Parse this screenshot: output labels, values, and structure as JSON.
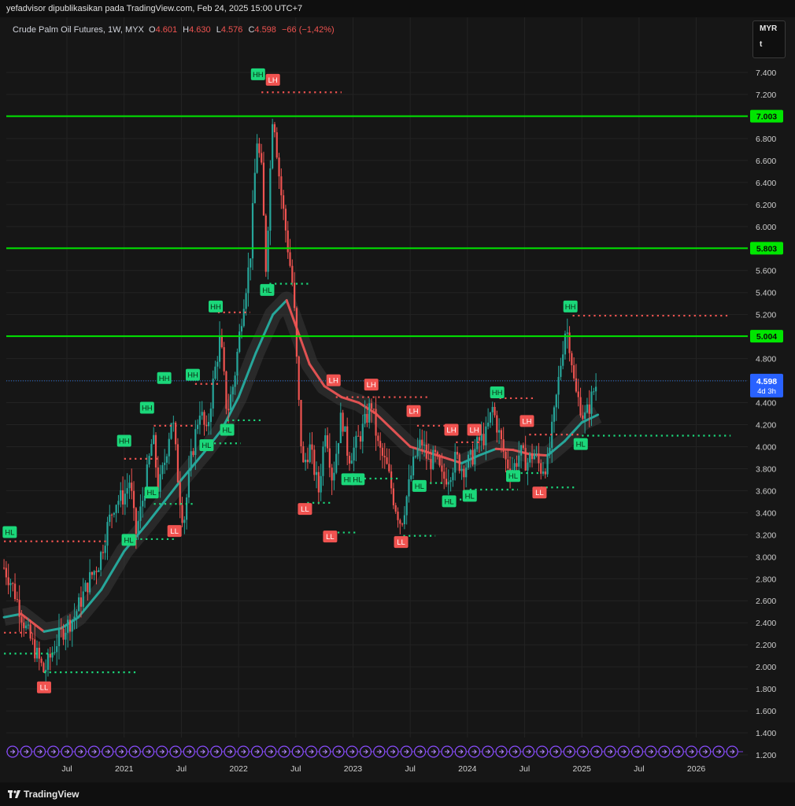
{
  "header": {
    "attribution": "yefadvisor dipublikasikan pada TradingView.com, Feb 24, 2025 15:00 UTC+7"
  },
  "legend": {
    "symbol": "Crude Palm Oil Futures, 1W, MYX",
    "o_label": "O",
    "o_value": "4.601",
    "h_label": "H",
    "h_value": "4.630",
    "l_label": "L",
    "l_value": "4.576",
    "c_label": "C",
    "c_value": "4.598",
    "change": "−66 (−1,42%)"
  },
  "currency": {
    "code": "MYR",
    "unit": "t"
  },
  "footer": {
    "brand": "TradingView"
  },
  "colors": {
    "up": "#26a69a",
    "down": "#ef5350",
    "level": "#00e600",
    "ma_up": "#26a69a",
    "ma_down": "#e05252",
    "hh": "#1bd77a",
    "lh": "#f05350"
  },
  "chart_data": {
    "type": "candlestick",
    "ylim": [
      1.15,
      7.55
    ],
    "x_range": [
      "2020-01",
      "2026-06"
    ],
    "y_ticks": [
      "1.200",
      "1.400",
      "1.600",
      "1.800",
      "2.000",
      "2.200",
      "2.400",
      "2.600",
      "2.800",
      "3.000",
      "3.200",
      "3.400",
      "3.600",
      "3.800",
      "4.000",
      "4.200",
      "4.400",
      "4.600",
      "4.800",
      "5.000",
      "5.200",
      "5.400",
      "5.600",
      "5.800",
      "6.000",
      "6.200",
      "6.400",
      "6.600",
      "6.800",
      "7.000",
      "7.200",
      "7.400"
    ],
    "x_ticks": [
      {
        "label": "Jul",
        "t": 2020.5
      },
      {
        "label": "2021",
        "t": 2021.0
      },
      {
        "label": "Jul",
        "t": 2021.5
      },
      {
        "label": "2022",
        "t": 2022.0
      },
      {
        "label": "Jul",
        "t": 2022.5
      },
      {
        "label": "2023",
        "t": 2023.0
      },
      {
        "label": "Jul",
        "t": 2023.5
      },
      {
        "label": "2024",
        "t": 2024.0
      },
      {
        "label": "Jul",
        "t": 2024.5
      },
      {
        "label": "2025",
        "t": 2025.0
      },
      {
        "label": "Jul",
        "t": 2025.5
      },
      {
        "label": "2026",
        "t": 2026.0
      }
    ],
    "horizontal_levels": [
      {
        "value": 7.003,
        "label": "7.003"
      },
      {
        "value": 5.803,
        "label": "5.803"
      },
      {
        "value": 5.004,
        "label": "5.004"
      }
    ],
    "last_price": {
      "value": 4.598,
      "label": "4.598",
      "countdown": "4d 3h"
    },
    "price_path": [
      [
        2019.95,
        2.9
      ],
      [
        2020.02,
        2.75
      ],
      [
        2020.08,
        2.55
      ],
      [
        2020.14,
        2.35
      ],
      [
        2020.2,
        2.2
      ],
      [
        2020.26,
        2.05
      ],
      [
        2020.3,
        1.95
      ],
      [
        2020.36,
        2.1
      ],
      [
        2020.42,
        2.25
      ],
      [
        2020.48,
        2.35
      ],
      [
        2020.56,
        2.45
      ],
      [
        2020.62,
        2.6
      ],
      [
        2020.7,
        2.8
      ],
      [
        2020.78,
        2.95
      ],
      [
        2020.86,
        3.3
      ],
      [
        2020.92,
        3.5
      ],
      [
        2021.0,
        3.55
      ],
      [
        2021.05,
        3.7
      ],
      [
        2021.1,
        3.2
      ],
      [
        2021.15,
        3.45
      ],
      [
        2021.2,
        3.75
      ],
      [
        2021.25,
        4.1
      ],
      [
        2021.3,
        3.6
      ],
      [
        2021.36,
        3.9
      ],
      [
        2021.42,
        4.3
      ],
      [
        2021.48,
        3.6
      ],
      [
        2021.52,
        3.3
      ],
      [
        2021.58,
        3.85
      ],
      [
        2021.66,
        4.35
      ],
      [
        2021.72,
        4.1
      ],
      [
        2021.78,
        4.6
      ],
      [
        2021.84,
        5.0
      ],
      [
        2021.9,
        4.3
      ],
      [
        2021.96,
        4.6
      ],
      [
        2022.04,
        5.3
      ],
      [
        2022.1,
        5.7
      ],
      [
        2022.16,
        6.8
      ],
      [
        2022.2,
        6.5
      ],
      [
        2022.24,
        5.6
      ],
      [
        2022.3,
        7.1
      ],
      [
        2022.36,
        6.4
      ],
      [
        2022.42,
        5.9
      ],
      [
        2022.48,
        5.4
      ],
      [
        2022.52,
        4.5
      ],
      [
        2022.56,
        3.8
      ],
      [
        2022.62,
        4.0
      ],
      [
        2022.7,
        3.6
      ],
      [
        2022.76,
        4.2
      ],
      [
        2022.82,
        3.7
      ],
      [
        2022.9,
        4.3
      ],
      [
        2022.96,
        3.9
      ],
      [
        2023.02,
        4.0
      ],
      [
        2023.1,
        4.2
      ],
      [
        2023.16,
        4.4
      ],
      [
        2023.22,
        4.0
      ],
      [
        2023.3,
        3.8
      ],
      [
        2023.36,
        3.5
      ],
      [
        2023.42,
        3.3
      ],
      [
        2023.48,
        3.6
      ],
      [
        2023.54,
        3.9
      ],
      [
        2023.6,
        4.05
      ],
      [
        2023.66,
        3.85
      ],
      [
        2023.72,
        3.9
      ],
      [
        2023.78,
        3.7
      ],
      [
        2023.84,
        3.75
      ],
      [
        2023.9,
        3.9
      ],
      [
        2023.96,
        3.8
      ],
      [
        2024.04,
        3.9
      ],
      [
        2024.1,
        4.05
      ],
      [
        2024.16,
        4.1
      ],
      [
        2024.22,
        4.35
      ],
      [
        2024.28,
        4.1
      ],
      [
        2024.34,
        3.85
      ],
      [
        2024.4,
        3.8
      ],
      [
        2024.46,
        3.95
      ],
      [
        2024.52,
        3.85
      ],
      [
        2024.58,
        3.95
      ],
      [
        2024.64,
        3.8
      ],
      [
        2024.7,
        3.85
      ],
      [
        2024.76,
        4.3
      ],
      [
        2024.82,
        4.8
      ],
      [
        2024.86,
        5.1
      ],
      [
        2024.9,
        4.9
      ],
      [
        2024.94,
        4.5
      ],
      [
        2024.98,
        4.4
      ],
      [
        2025.02,
        4.25
      ],
      [
        2025.06,
        4.35
      ],
      [
        2025.1,
        4.5
      ],
      [
        2025.14,
        4.6
      ]
    ],
    "moving_average": [
      [
        2019.95,
        2.45
      ],
      [
        2020.1,
        2.48
      ],
      [
        2020.3,
        2.32
      ],
      [
        2020.45,
        2.35
      ],
      [
        2020.6,
        2.45
      ],
      [
        2020.8,
        2.7
      ],
      [
        2021.0,
        3.05
      ],
      [
        2021.2,
        3.3
      ],
      [
        2021.35,
        3.5
      ],
      [
        2021.5,
        3.7
      ],
      [
        2021.7,
        3.95
      ],
      [
        2021.85,
        4.15
      ],
      [
        2022.0,
        4.45
      ],
      [
        2022.15,
        4.85
      ],
      [
        2022.3,
        5.2
      ],
      [
        2022.42,
        5.33
      ],
      [
        2022.5,
        5.1
      ],
      [
        2022.62,
        4.75
      ],
      [
        2022.75,
        4.55
      ],
      [
        2022.9,
        4.45
      ],
      [
        2023.05,
        4.4
      ],
      [
        2023.2,
        4.3
      ],
      [
        2023.35,
        4.15
      ],
      [
        2023.5,
        4.0
      ],
      [
        2023.65,
        3.95
      ],
      [
        2023.8,
        3.9
      ],
      [
        2023.95,
        3.85
      ],
      [
        2024.1,
        3.92
      ],
      [
        2024.25,
        3.98
      ],
      [
        2024.4,
        3.97
      ],
      [
        2024.55,
        3.93
      ],
      [
        2024.7,
        3.92
      ],
      [
        2024.85,
        4.05
      ],
      [
        2025.0,
        4.22
      ],
      [
        2025.14,
        4.29
      ]
    ],
    "markers": [
      {
        "label": "HH",
        "t": 2022.17,
        "v": 7.38,
        "kind": "hh"
      },
      {
        "label": "LH",
        "t": 2022.3,
        "v": 7.33,
        "kind": "lh"
      },
      {
        "label": "HL",
        "t": 2022.25,
        "v": 5.42,
        "kind": "hh"
      },
      {
        "label": "HH",
        "t": 2021.8,
        "v": 5.27,
        "kind": "hh"
      },
      {
        "label": "HH",
        "t": 2021.35,
        "v": 4.62,
        "kind": "hh"
      },
      {
        "label": "HH",
        "t": 2021.6,
        "v": 4.65,
        "kind": "hh"
      },
      {
        "label": "HH",
        "t": 2021.2,
        "v": 4.35,
        "kind": "hh"
      },
      {
        "label": "HH",
        "t": 221.01,
        "v": 0,
        "kind": "skip"
      },
      {
        "label": "HH",
        "t": 2021.0,
        "v": 4.05,
        "kind": "hh"
      },
      {
        "label": "HL",
        "t": 2021.9,
        "v": 4.15,
        "kind": "hh"
      },
      {
        "label": "HL",
        "t": 2021.72,
        "v": 4.01,
        "kind": "hh"
      },
      {
        "label": "HL",
        "t": 2021.24,
        "v": 3.58,
        "kind": "hh"
      },
      {
        "label": "HL",
        "t": 2021.04,
        "v": 3.15,
        "kind": "hh"
      },
      {
        "label": "LL",
        "t": 2021.44,
        "v": 3.23,
        "kind": "lh"
      },
      {
        "label": "LL",
        "t": 2020.3,
        "v": 1.81,
        "kind": "lh"
      },
      {
        "label": "LL",
        "t": 2022.58,
        "v": 3.43,
        "kind": "lh"
      },
      {
        "label": "LL",
        "t": 2022.8,
        "v": 3.18,
        "kind": "lh"
      },
      {
        "label": "LL",
        "t": 2023.42,
        "v": 3.13,
        "kind": "lh"
      },
      {
        "label": "LH",
        "t": 2022.83,
        "v": 4.6,
        "kind": "lh"
      },
      {
        "label": "LH",
        "t": 2023.16,
        "v": 4.56,
        "kind": "lh"
      },
      {
        "label": "LH",
        "t": 2023.53,
        "v": 4.32,
        "kind": "lh"
      },
      {
        "label": "LH",
        "t": 2023.86,
        "v": 4.15,
        "kind": "lh"
      },
      {
        "label": "LH",
        "t": 2024.06,
        "v": 4.15,
        "kind": "lh"
      },
      {
        "label": "LH",
        "t": 2024.52,
        "v": 4.23,
        "kind": "lh"
      },
      {
        "label": "LL",
        "t": 2024.63,
        "v": 3.58,
        "kind": "lh"
      },
      {
        "label": "HL",
        "t": 2022.96,
        "v": 3.7,
        "kind": "hh"
      },
      {
        "label": "HL",
        "t": 2023.04,
        "v": 3.7,
        "kind": "hh"
      },
      {
        "label": "HL",
        "t": 2023.58,
        "v": 3.64,
        "kind": "hh"
      },
      {
        "label": "HL",
        "t": 2023.84,
        "v": 3.5,
        "kind": "hh"
      },
      {
        "label": "HL",
        "t": 2024.02,
        "v": 3.55,
        "kind": "hh"
      },
      {
        "label": "HL",
        "t": 2024.4,
        "v": 3.73,
        "kind": "hh"
      },
      {
        "label": "HH",
        "t": 2024.26,
        "v": 4.49,
        "kind": "hh"
      },
      {
        "label": "HH",
        "t": 2024.9,
        "v": 5.27,
        "kind": "hh"
      },
      {
        "label": "HL",
        "t": 2024.99,
        "v": 4.02,
        "kind": "hh"
      },
      {
        "label": "HL",
        "t": 2020.0,
        "v": 3.22,
        "kind": "hh"
      }
    ],
    "dotted_levels": [
      {
        "v": 7.22,
        "t0": 2022.2,
        "t1": 2022.9,
        "kind": "lh"
      },
      {
        "v": 5.48,
        "t0": 2022.27,
        "t1": 2022.62,
        "kind": "hh"
      },
      {
        "v": 5.22,
        "t0": 2021.82,
        "t1": 2022.1,
        "kind": "lh"
      },
      {
        "v": 5.19,
        "t0": 2024.92,
        "t1": 2026.3,
        "kind": "lh"
      },
      {
        "v": 4.57,
        "t0": 2021.62,
        "t1": 2021.82,
        "kind": "lh"
      },
      {
        "v": 4.45,
        "t0": 2022.85,
        "t1": 2023.65,
        "kind": "lh"
      },
      {
        "v": 4.44,
        "t0": 2024.28,
        "t1": 2024.6,
        "kind": "lh"
      },
      {
        "v": 4.24,
        "t0": 2021.9,
        "t1": 2022.22,
        "kind": "hh"
      },
      {
        "v": 4.19,
        "t0": 2021.26,
        "t1": 2021.6,
        "kind": "lh"
      },
      {
        "v": 4.19,
        "t0": 2023.56,
        "t1": 2023.9,
        "kind": "lh"
      },
      {
        "v": 4.11,
        "t0": 2024.54,
        "t1": 2025.0,
        "kind": "lh"
      },
      {
        "v": 4.1,
        "t0": 2025.0,
        "t1": 2026.3,
        "kind": "hh"
      },
      {
        "v": 4.04,
        "t0": 2023.9,
        "t1": 2024.1,
        "kind": "lh"
      },
      {
        "v": 4.03,
        "t0": 2021.74,
        "t1": 2022.02,
        "kind": "hh"
      },
      {
        "v": 3.89,
        "t0": 2021.0,
        "t1": 2021.3,
        "kind": "lh"
      },
      {
        "v": 3.76,
        "t0": 2024.42,
        "t1": 2024.62,
        "kind": "hh"
      },
      {
        "v": 3.71,
        "t0": 2022.96,
        "t1": 2023.4,
        "kind": "hh"
      },
      {
        "v": 3.67,
        "t0": 2023.58,
        "t1": 2023.8,
        "kind": "hh"
      },
      {
        "v": 3.63,
        "t0": 2024.64,
        "t1": 2024.96,
        "kind": "hh"
      },
      {
        "v": 3.61,
        "t0": 2024.02,
        "t1": 2024.44,
        "kind": "hh"
      },
      {
        "v": 3.52,
        "t0": 2023.84,
        "t1": 2024.02,
        "kind": "hh"
      },
      {
        "v": 3.49,
        "t0": 2022.6,
        "t1": 2022.82,
        "kind": "hh"
      },
      {
        "v": 3.48,
        "t0": 2021.26,
        "t1": 2021.62,
        "kind": "hh"
      },
      {
        "v": 3.22,
        "t0": 2022.82,
        "t1": 2023.02,
        "kind": "hh"
      },
      {
        "v": 3.19,
        "t0": 2023.44,
        "t1": 2023.72,
        "kind": "hh"
      },
      {
        "v": 3.16,
        "t0": 2021.05,
        "t1": 2021.44,
        "kind": "hh"
      },
      {
        "v": 3.14,
        "t0": 2019.95,
        "t1": 2020.85,
        "kind": "lh"
      },
      {
        "v": 2.31,
        "t0": 2019.95,
        "t1": 2020.2,
        "kind": "lh"
      },
      {
        "v": 2.12,
        "t0": 2019.95,
        "t1": 2020.4,
        "kind": "hh"
      },
      {
        "v": 1.95,
        "t0": 2020.3,
        "t1": 2021.1,
        "kind": "hh"
      }
    ]
  }
}
